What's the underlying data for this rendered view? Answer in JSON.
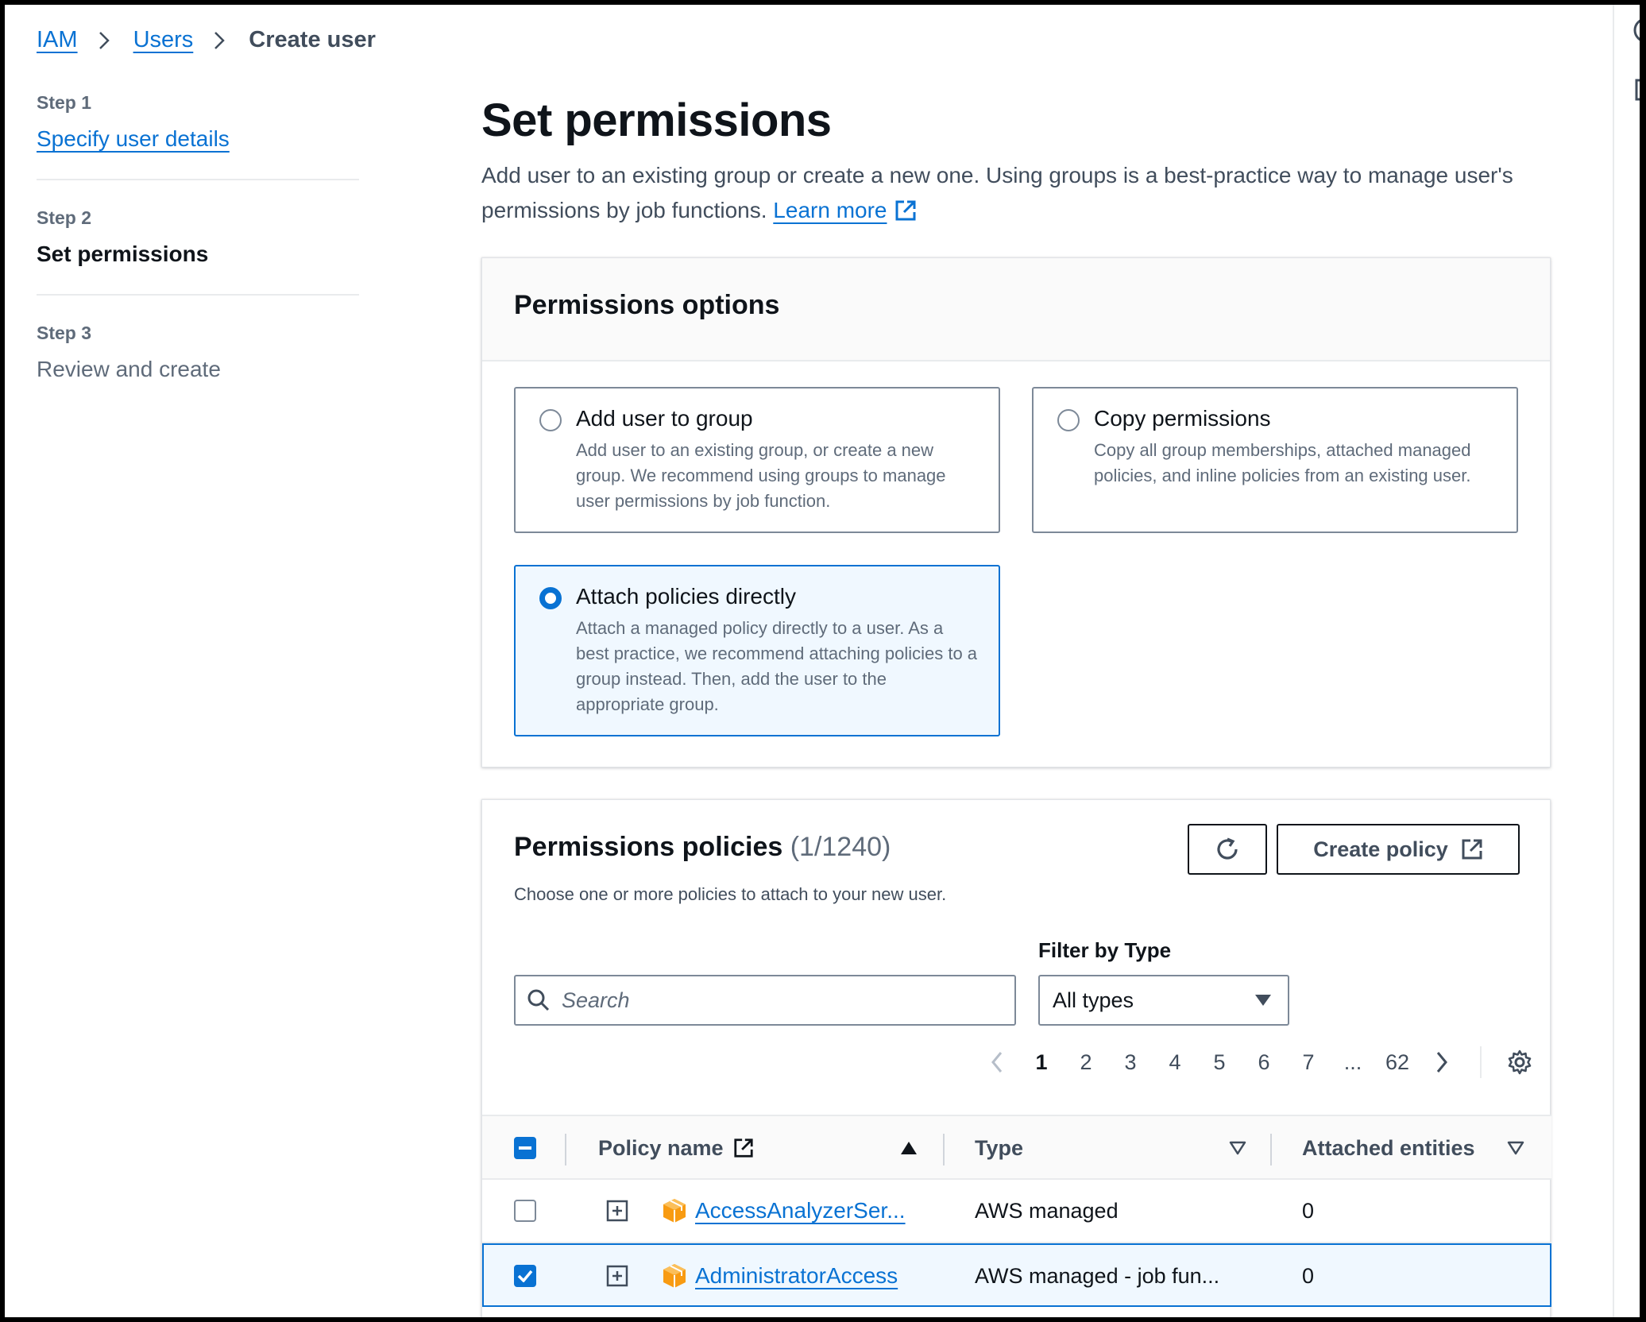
{
  "breadcrumb": {
    "items": [
      "IAM",
      "Users"
    ],
    "current": "Create user"
  },
  "steps": [
    {
      "number": "Step 1",
      "label": "Specify user details"
    },
    {
      "number": "Step 2",
      "label": "Set permissions"
    },
    {
      "number": "Step 3",
      "label": "Review and create"
    }
  ],
  "page": {
    "title": "Set permissions",
    "description": "Add user to an existing group or create a new one. Using groups is a best-practice way to manage user's permissions by job functions.",
    "learn_more": "Learn more"
  },
  "permissions_options": {
    "title": "Permissions options",
    "selected": "Attach policies directly",
    "tiles": [
      {
        "title": "Add user to group",
        "desc": "Add user to an existing group, or create a new group. We recommend using groups to manage user permissions by job function."
      },
      {
        "title": "Copy permissions",
        "desc": "Copy all group memberships, attached managed policies, and inline policies from an existing user."
      },
      {
        "title": "Attach policies directly",
        "desc": "Attach a managed policy directly to a user. As a best practice, we recommend attaching policies to a group instead. Then, add the user to the appropriate group."
      }
    ]
  },
  "policies": {
    "title": "Permissions policies",
    "count": "(1/1240)",
    "description": "Choose one or more policies to attach to your new user.",
    "create_button": "Create policy",
    "filter_label": "Filter by Type",
    "search_placeholder": "Search",
    "filter_value": "All types",
    "pagination": {
      "pages": [
        "1",
        "2",
        "3",
        "4",
        "5",
        "6",
        "7",
        "...",
        "62"
      ],
      "current": "1"
    },
    "columns": {
      "name": "Policy name",
      "type": "Type",
      "attached": "Attached entities"
    },
    "rows": [
      {
        "name": "AccessAnalyzerSer...",
        "type": "AWS managed",
        "attached": "0",
        "checked": false
      },
      {
        "name": "AdministratorAccess",
        "type": "AWS managed - job fun...",
        "attached": "0",
        "checked": true
      }
    ]
  },
  "colors": {
    "link": "#0972d3",
    "selected_bg": "#f0f8ff",
    "aws_icon": "#f89b12"
  }
}
